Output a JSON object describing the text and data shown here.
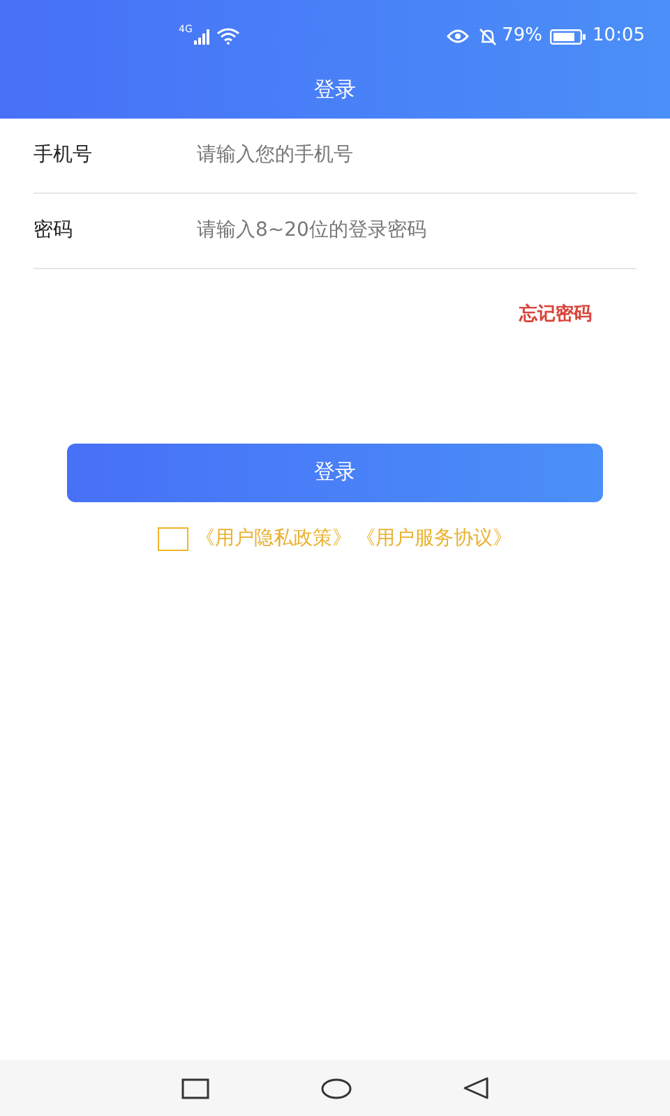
{
  "status_bar": {
    "network": "4G",
    "battery": "79%",
    "time": "10:05"
  },
  "header": {
    "title": "登录"
  },
  "fields": [
    {
      "label": "手机号",
      "placeholder": "请输入您的手机号"
    },
    {
      "label": "密码",
      "placeholder": "请输入8~20位的登录密码"
    }
  ],
  "forgot_password": "忘记密码",
  "login_button": "登录",
  "agreement": {
    "checked": false,
    "links": [
      "《用户隐私政策》",
      "《用户服务协议》"
    ]
  }
}
